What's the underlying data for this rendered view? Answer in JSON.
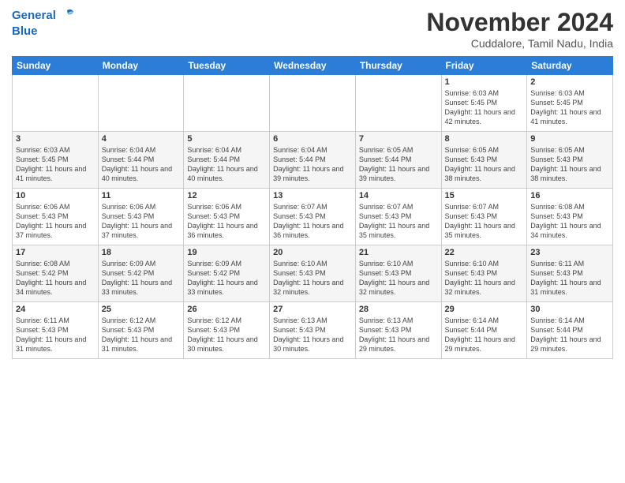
{
  "header": {
    "logo_line1": "General",
    "logo_line2": "Blue",
    "title": "November 2024",
    "subtitle": "Cuddalore, Tamil Nadu, India"
  },
  "days_of_week": [
    "Sunday",
    "Monday",
    "Tuesday",
    "Wednesday",
    "Thursday",
    "Friday",
    "Saturday"
  ],
  "weeks": [
    [
      {
        "day": "",
        "info": ""
      },
      {
        "day": "",
        "info": ""
      },
      {
        "day": "",
        "info": ""
      },
      {
        "day": "",
        "info": ""
      },
      {
        "day": "",
        "info": ""
      },
      {
        "day": "1",
        "info": "Sunrise: 6:03 AM\nSunset: 5:45 PM\nDaylight: 11 hours and 42 minutes."
      },
      {
        "day": "2",
        "info": "Sunrise: 6:03 AM\nSunset: 5:45 PM\nDaylight: 11 hours and 41 minutes."
      }
    ],
    [
      {
        "day": "3",
        "info": "Sunrise: 6:03 AM\nSunset: 5:45 PM\nDaylight: 11 hours and 41 minutes."
      },
      {
        "day": "4",
        "info": "Sunrise: 6:04 AM\nSunset: 5:44 PM\nDaylight: 11 hours and 40 minutes."
      },
      {
        "day": "5",
        "info": "Sunrise: 6:04 AM\nSunset: 5:44 PM\nDaylight: 11 hours and 40 minutes."
      },
      {
        "day": "6",
        "info": "Sunrise: 6:04 AM\nSunset: 5:44 PM\nDaylight: 11 hours and 39 minutes."
      },
      {
        "day": "7",
        "info": "Sunrise: 6:05 AM\nSunset: 5:44 PM\nDaylight: 11 hours and 39 minutes."
      },
      {
        "day": "8",
        "info": "Sunrise: 6:05 AM\nSunset: 5:43 PM\nDaylight: 11 hours and 38 minutes."
      },
      {
        "day": "9",
        "info": "Sunrise: 6:05 AM\nSunset: 5:43 PM\nDaylight: 11 hours and 38 minutes."
      }
    ],
    [
      {
        "day": "10",
        "info": "Sunrise: 6:06 AM\nSunset: 5:43 PM\nDaylight: 11 hours and 37 minutes."
      },
      {
        "day": "11",
        "info": "Sunrise: 6:06 AM\nSunset: 5:43 PM\nDaylight: 11 hours and 37 minutes."
      },
      {
        "day": "12",
        "info": "Sunrise: 6:06 AM\nSunset: 5:43 PM\nDaylight: 11 hours and 36 minutes."
      },
      {
        "day": "13",
        "info": "Sunrise: 6:07 AM\nSunset: 5:43 PM\nDaylight: 11 hours and 36 minutes."
      },
      {
        "day": "14",
        "info": "Sunrise: 6:07 AM\nSunset: 5:43 PM\nDaylight: 11 hours and 35 minutes."
      },
      {
        "day": "15",
        "info": "Sunrise: 6:07 AM\nSunset: 5:43 PM\nDaylight: 11 hours and 35 minutes."
      },
      {
        "day": "16",
        "info": "Sunrise: 6:08 AM\nSunset: 5:43 PM\nDaylight: 11 hours and 34 minutes."
      }
    ],
    [
      {
        "day": "17",
        "info": "Sunrise: 6:08 AM\nSunset: 5:42 PM\nDaylight: 11 hours and 34 minutes."
      },
      {
        "day": "18",
        "info": "Sunrise: 6:09 AM\nSunset: 5:42 PM\nDaylight: 11 hours and 33 minutes."
      },
      {
        "day": "19",
        "info": "Sunrise: 6:09 AM\nSunset: 5:42 PM\nDaylight: 11 hours and 33 minutes."
      },
      {
        "day": "20",
        "info": "Sunrise: 6:10 AM\nSunset: 5:43 PM\nDaylight: 11 hours and 32 minutes."
      },
      {
        "day": "21",
        "info": "Sunrise: 6:10 AM\nSunset: 5:43 PM\nDaylight: 11 hours and 32 minutes."
      },
      {
        "day": "22",
        "info": "Sunrise: 6:10 AM\nSunset: 5:43 PM\nDaylight: 11 hours and 32 minutes."
      },
      {
        "day": "23",
        "info": "Sunrise: 6:11 AM\nSunset: 5:43 PM\nDaylight: 11 hours and 31 minutes."
      }
    ],
    [
      {
        "day": "24",
        "info": "Sunrise: 6:11 AM\nSunset: 5:43 PM\nDaylight: 11 hours and 31 minutes."
      },
      {
        "day": "25",
        "info": "Sunrise: 6:12 AM\nSunset: 5:43 PM\nDaylight: 11 hours and 31 minutes."
      },
      {
        "day": "26",
        "info": "Sunrise: 6:12 AM\nSunset: 5:43 PM\nDaylight: 11 hours and 30 minutes."
      },
      {
        "day": "27",
        "info": "Sunrise: 6:13 AM\nSunset: 5:43 PM\nDaylight: 11 hours and 30 minutes."
      },
      {
        "day": "28",
        "info": "Sunrise: 6:13 AM\nSunset: 5:43 PM\nDaylight: 11 hours and 29 minutes."
      },
      {
        "day": "29",
        "info": "Sunrise: 6:14 AM\nSunset: 5:44 PM\nDaylight: 11 hours and 29 minutes."
      },
      {
        "day": "30",
        "info": "Sunrise: 6:14 AM\nSunset: 5:44 PM\nDaylight: 11 hours and 29 minutes."
      }
    ]
  ]
}
